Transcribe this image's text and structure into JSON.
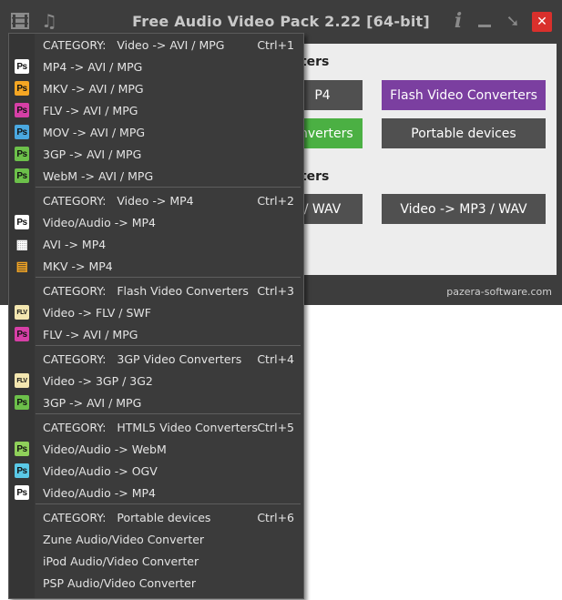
{
  "window": {
    "title": "Free Audio Video Pack 2.22 [64-bit]",
    "status_site": "pazera-software.com",
    "accent_close": "#d9302c"
  },
  "content": {
    "section1_title": "rters",
    "section2_title": "rters",
    "tiles": [
      {
        "label": "P4",
        "color": "#505050"
      },
      {
        "label": "Flash Video Converters",
        "color": "#7b3fa0"
      },
      {
        "label": "onverters",
        "color": "#4bb043"
      },
      {
        "label": "Portable devices",
        "color": "#505050"
      },
      {
        "label": "/ WAV",
        "color": "#505050"
      },
      {
        "label": "Video -> MP3 / WAV",
        "color": "#505050"
      }
    ]
  },
  "menu": {
    "items": [
      {
        "label": "CATEGORY:   Video -> AVI / MPG",
        "shortcut": "Ctrl+1",
        "icon": "",
        "icon_name": "none"
      },
      {
        "label": "MP4 -> AVI / MPG",
        "shortcut": "",
        "icon": "Ps",
        "icon_name": "ps-white-icon",
        "icon_color": "#ffffff"
      },
      {
        "label": "MKV -> AVI / MPG",
        "shortcut": "",
        "icon": "Ps",
        "icon_name": "ps-orange-icon",
        "icon_color": "#f5a623"
      },
      {
        "label": "FLV -> AVI / MPG",
        "shortcut": "",
        "icon": "Ps",
        "icon_name": "ps-magenta-icon",
        "icon_color": "#d63fa6"
      },
      {
        "label": "MOV -> AVI / MPG",
        "shortcut": "",
        "icon": "Ps",
        "icon_name": "ps-blue-icon",
        "icon_color": "#4aa8e0"
      },
      {
        "label": "3GP -> AVI / MPG",
        "shortcut": "",
        "icon": "Ps",
        "icon_name": "ps-green-icon",
        "icon_color": "#6cc04a"
      },
      {
        "label": "WebM -> AVI / MPG",
        "shortcut": "",
        "icon": "Ps",
        "icon_name": "ps-green-icon",
        "icon_color": "#6cc04a"
      },
      {
        "label": "CATEGORY:   Video -> MP4",
        "shortcut": "Ctrl+2",
        "icon": "",
        "icon_name": "none"
      },
      {
        "label": "Video/Audio -> MP4",
        "shortcut": "",
        "icon": "Ps",
        "icon_name": "ps-white-icon",
        "icon_color": "#ffffff"
      },
      {
        "label": "AVI -> MP4",
        "shortcut": "",
        "icon": "▦",
        "icon_name": "film-icon",
        "icon_color": "#ffffff"
      },
      {
        "label": "MKV -> MP4",
        "shortcut": "",
        "icon": "▤",
        "icon_name": "film-orange-icon",
        "icon_color": "#f5a623"
      },
      {
        "label": "CATEGORY:   Flash Video Converters",
        "shortcut": "Ctrl+3",
        "icon": "",
        "icon_name": "none"
      },
      {
        "label": "Video -> FLV / SWF",
        "shortcut": "",
        "icon": "FLV",
        "icon_name": "flv-icon",
        "icon_color": "#f3e6b0"
      },
      {
        "label": "FLV -> AVI / MPG",
        "shortcut": "",
        "icon": "Ps",
        "icon_name": "ps-magenta-icon",
        "icon_color": "#d63fa6"
      },
      {
        "label": "CATEGORY:   3GP Video Converters",
        "shortcut": "Ctrl+4",
        "icon": "",
        "icon_name": "none"
      },
      {
        "label": "Video -> 3GP / 3G2",
        "shortcut": "",
        "icon": "FLV",
        "icon_name": "flv-icon",
        "icon_color": "#f3e6b0"
      },
      {
        "label": "3GP -> AVI / MPG",
        "shortcut": "",
        "icon": "Ps",
        "icon_name": "ps-green-icon",
        "icon_color": "#6cc04a"
      },
      {
        "label": "CATEGORY:   HTML5 Video Converters",
        "shortcut": "Ctrl+5",
        "icon": "",
        "icon_name": "none"
      },
      {
        "label": "Video/Audio -> WebM",
        "shortcut": "",
        "icon": "Ps",
        "icon_name": "ps-green-icon",
        "icon_color": "#8fd05a"
      },
      {
        "label": "Video/Audio -> OGV",
        "shortcut": "",
        "icon": "Ps",
        "icon_name": "ps-cyan-icon",
        "icon_color": "#5ac8e6"
      },
      {
        "label": "Video/Audio -> MP4",
        "shortcut": "",
        "icon": "Ps",
        "icon_name": "ps-white-icon",
        "icon_color": "#ffffff"
      },
      {
        "label": "CATEGORY:   Portable devices",
        "shortcut": "Ctrl+6",
        "icon": "",
        "icon_name": "none"
      },
      {
        "label": "Zune Audio/Video Converter",
        "shortcut": "",
        "icon": "",
        "icon_name": "none"
      },
      {
        "label": "iPod Audio/Video Converter",
        "shortcut": "",
        "icon": "",
        "icon_name": "none"
      },
      {
        "label": "PSP Audio/Video Converter",
        "shortcut": "",
        "icon": "",
        "icon_name": "none"
      }
    ]
  }
}
